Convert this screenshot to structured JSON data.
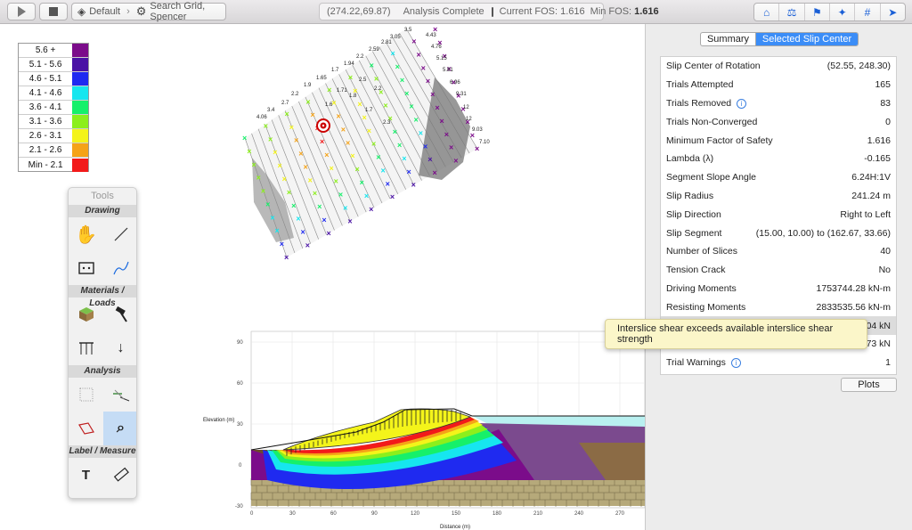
{
  "toolbar": {
    "layer_label": "Default",
    "search_label": "Search Grid, Spencer",
    "coords": "(274.22,69.87)",
    "analysis_status": "Analysis Complete",
    "current_fos_label": "Current FOS: 1.616",
    "min_fos_label": "Min FOS:",
    "min_fos_value": "1.616"
  },
  "legend": [
    {
      "label": "5.6 +",
      "color": "#7b0c8a"
    },
    {
      "label": "5.1 - 5.6",
      "color": "#4a12a5"
    },
    {
      "label": "4.6 - 5.1",
      "color": "#1f2af0"
    },
    {
      "label": "4.1 - 4.6",
      "color": "#16e6ef"
    },
    {
      "label": "3.6 - 4.1",
      "color": "#16f06a"
    },
    {
      "label": "3.1 - 3.6",
      "color": "#8cef1c"
    },
    {
      "label": "2.6 - 3.1",
      "color": "#f4f41a"
    },
    {
      "label": "2.1 - 2.6",
      "color": "#f5a318"
    },
    {
      "label": "Min - 2.1",
      "color": "#f21a1a"
    }
  ],
  "tools": {
    "title": "Tools",
    "sections": {
      "drawing": "Drawing",
      "materials": "Materials / Loads",
      "analysis": "Analysis",
      "label_measure": "Label / Measure"
    }
  },
  "panel": {
    "tab_summary": "Summary",
    "tab_selected": "Selected Slip Center",
    "rows": [
      {
        "label": "Slip Center of Rotation",
        "value": "(52.55, 248.30)"
      },
      {
        "label": "Trials Attempted",
        "value": "165"
      },
      {
        "label": "Trials Removed",
        "value": "83"
      },
      {
        "label": "Trials Non-Converged",
        "value": "0"
      },
      {
        "label": "Minimum Factor of Safety",
        "value": "1.616"
      },
      {
        "label": "Lambda (λ)",
        "value": "-0.165"
      },
      {
        "label": "Segment Slope Angle",
        "value": "6.24H:1V"
      },
      {
        "label": "Slip Radius",
        "value": "241.24 m"
      },
      {
        "label": "Slip Direction",
        "value": "Right to Left"
      },
      {
        "label": "Slip Segment",
        "value": "(15.00, 10.00) to (162.67, 33.66)"
      },
      {
        "label": "Number of Slices",
        "value": "40"
      },
      {
        "label": "Tension Crack",
        "value": "No"
      },
      {
        "label": "Driving Moments",
        "value": "1753744.28 kN-m"
      },
      {
        "label": "Resisting Moments",
        "value": "2833535.56 kN-m"
      },
      {
        "label": "",
        "value": "04 kN"
      },
      {
        "label": "",
        "value": "73 kN"
      },
      {
        "label": "Trial Warnings",
        "value": "1"
      }
    ],
    "plots_label": "Plots",
    "tooltip": "Interslice shear exceeds available interslice shear strength"
  },
  "plot": {
    "ylabel": "Elevation (m)",
    "xlabel": "Distance (m)",
    "y_ticks": [
      "90",
      "60",
      "30",
      "0",
      "-30"
    ],
    "x_ticks": [
      "0",
      "30",
      "60",
      "90",
      "120",
      "150",
      "180",
      "210",
      "240",
      "270"
    ]
  },
  "grid_labels": {
    "fos": [
      "3.5",
      "4.43",
      "3.05",
      "4.76",
      "2.81",
      "5.15",
      "2.59",
      "5.81",
      "2.2",
      "6.96",
      "1.94",
      "9.31",
      "1.7",
      "12",
      "1.65",
      "12",
      "1.9",
      "9.03",
      "2.2",
      "7.10",
      "2.7",
      "3.4",
      "4.06",
      "1.6",
      "1.71",
      "2.5",
      "2.2",
      "1.8",
      "1.7",
      "2.3"
    ]
  }
}
